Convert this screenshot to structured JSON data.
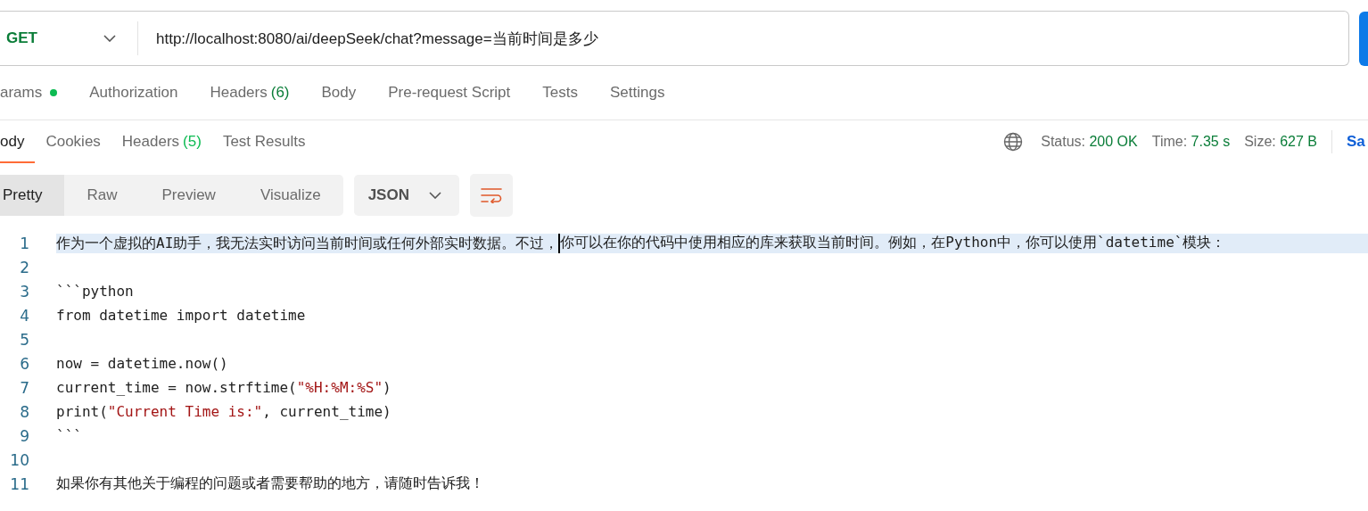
{
  "request": {
    "method": "GET",
    "url": "http://localhost:8080/ai/deepSeek/chat?message=当前时间是多少"
  },
  "request_tabs": [
    {
      "label": "arams",
      "dot": true,
      "selected": false
    },
    {
      "label": "Authorization",
      "dot": false,
      "selected": false
    },
    {
      "label": "Headers",
      "count": "(6)",
      "dot": false,
      "selected": false
    },
    {
      "label": "Body",
      "dot": false,
      "selected": false
    },
    {
      "label": "Pre-request Script",
      "dot": false,
      "selected": false
    },
    {
      "label": "Tests",
      "dot": false,
      "selected": false
    },
    {
      "label": "Settings",
      "dot": false,
      "selected": false
    }
  ],
  "response_tabs": [
    {
      "label": "ody",
      "selected": true
    },
    {
      "label": "Cookies",
      "selected": false
    },
    {
      "label": "Headers",
      "count": "(5)",
      "selected": false
    },
    {
      "label": "Test Results",
      "selected": false
    }
  ],
  "response_meta": [
    {
      "label": "Status:",
      "value": "200 OK"
    },
    {
      "label": "Time:",
      "value": "7.35 s"
    },
    {
      "label": "Size:",
      "value": "627 B"
    }
  ],
  "save_label": "Sa",
  "view_modes": [
    {
      "label": "Pretty",
      "selected": true
    },
    {
      "label": "Raw",
      "selected": false
    },
    {
      "label": "Preview",
      "selected": false
    },
    {
      "label": "Visualize",
      "selected": false
    }
  ],
  "format": "JSON",
  "lines": [
    {
      "number": "1",
      "highlighted": true,
      "segments": [
        {
          "kind": "plain",
          "text": "作为一个虚拟的AI助手，我无法实时访问当前时间或任何外部实时数据。不过，",
          "cursor": true
        },
        {
          "kind": "plain",
          "text": "你可以在你的代码中使用相应的库来获取当前时间。例如，在Python中，你可以使用`datetime`模块：",
          "cursor": false
        }
      ]
    },
    {
      "number": "2",
      "highlighted": false
    },
    {
      "number": "3",
      "highlighted": false,
      "segments": [
        {
          "kind": "plain",
          "text": "```python",
          "cursor": false
        }
      ]
    },
    {
      "number": "4",
      "highlighted": false,
      "segments": [
        {
          "kind": "plain",
          "text": "from datetime import datetime",
          "cursor": false
        }
      ]
    },
    {
      "number": "5",
      "highlighted": false
    },
    {
      "number": "6",
      "highlighted": false,
      "segments": [
        {
          "kind": "plain",
          "text": "now = datetime.now()",
          "cursor": false
        }
      ]
    },
    {
      "number": "7",
      "highlighted": false,
      "segments": [
        {
          "kind": "plain",
          "text": "current_time = now.strftime(",
          "cursor": false
        },
        {
          "kind": "string",
          "text": "\"%H:%M:%S\"",
          "cursor": false
        },
        {
          "kind": "plain",
          "text": ")",
          "cursor": false
        }
      ]
    },
    {
      "number": "8",
      "highlighted": false,
      "segments": [
        {
          "kind": "plain",
          "text": "print(",
          "cursor": false
        },
        {
          "kind": "string",
          "text": "\"Current Time is:\"",
          "cursor": false
        },
        {
          "kind": "plain",
          "text": ", current_time)",
          "cursor": false
        }
      ]
    },
    {
      "number": "9",
      "highlighted": false,
      "segments": [
        {
          "kind": "plain",
          "text": "```",
          "cursor": false
        }
      ]
    },
    {
      "number": "10",
      "highlighted": false
    },
    {
      "number": "11",
      "highlighted": false,
      "segments": [
        {
          "kind": "plain",
          "text": "如果你有其他关于编程的问题或者需要帮助的地方，请随时告诉我！",
          "cursor": false
        }
      ]
    }
  ]
}
